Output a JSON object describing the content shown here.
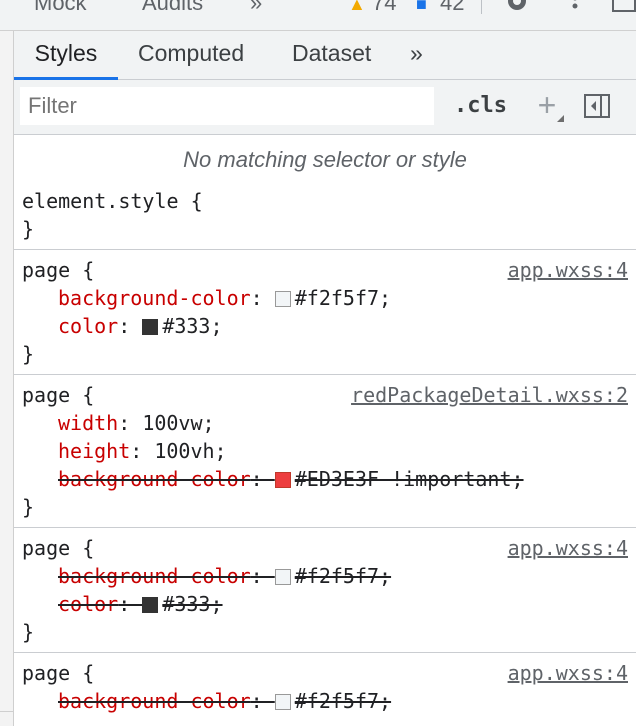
{
  "topbar": {
    "items": [
      "Mock",
      "Audits",
      "»",
      "74",
      "42"
    ]
  },
  "tabs": [
    {
      "label": "Styles",
      "active": true
    },
    {
      "label": "Computed",
      "active": false
    },
    {
      "label": "Dataset",
      "active": false
    },
    {
      "label": "»",
      "active": false
    }
  ],
  "toolbar": {
    "filter_placeholder": "Filter",
    "cls_label": ".cls",
    "plus_label": "+"
  },
  "no_match_text": "No matching selector or style",
  "element_style": {
    "open": "element.style {",
    "close": "}"
  },
  "rules": [
    {
      "selector": "page {",
      "source": "app.wxss:4",
      "declarations": [
        {
          "prop": "background-color",
          "value": "#f2f5f7;",
          "swatch": "#f2f5f7",
          "overridden": false
        },
        {
          "prop": "color",
          "value": "#333;",
          "swatch": "#333333",
          "overridden": false
        }
      ],
      "close": "}"
    },
    {
      "selector": "page {",
      "source": "redPackageDetail.wxss:2",
      "declarations": [
        {
          "prop": "width",
          "value": "100vw;",
          "swatch": null,
          "overridden": false
        },
        {
          "prop": "height",
          "value": "100vh;",
          "swatch": null,
          "overridden": false
        },
        {
          "prop": "background-color",
          "value": "#ED3E3F !important;",
          "swatch": "#ED3E3F",
          "overridden": true
        }
      ],
      "close": "}"
    },
    {
      "selector": "page {",
      "source": "app.wxss:4",
      "declarations": [
        {
          "prop": "background-color",
          "value": "#f2f5f7;",
          "swatch": "#f2f5f7",
          "overridden": true
        },
        {
          "prop": "color",
          "value": "#333;",
          "swatch": "#333333",
          "overridden": true
        }
      ],
      "close": "}"
    },
    {
      "selector": "page {",
      "source": "app.wxss:4",
      "declarations": [
        {
          "prop": "background-color",
          "value": "#f2f5f7;",
          "swatch": "#f2f5f7",
          "overridden": true
        }
      ],
      "close": ""
    }
  ],
  "colors": {
    "accent": "#1a73e8",
    "property": "#c80000"
  }
}
